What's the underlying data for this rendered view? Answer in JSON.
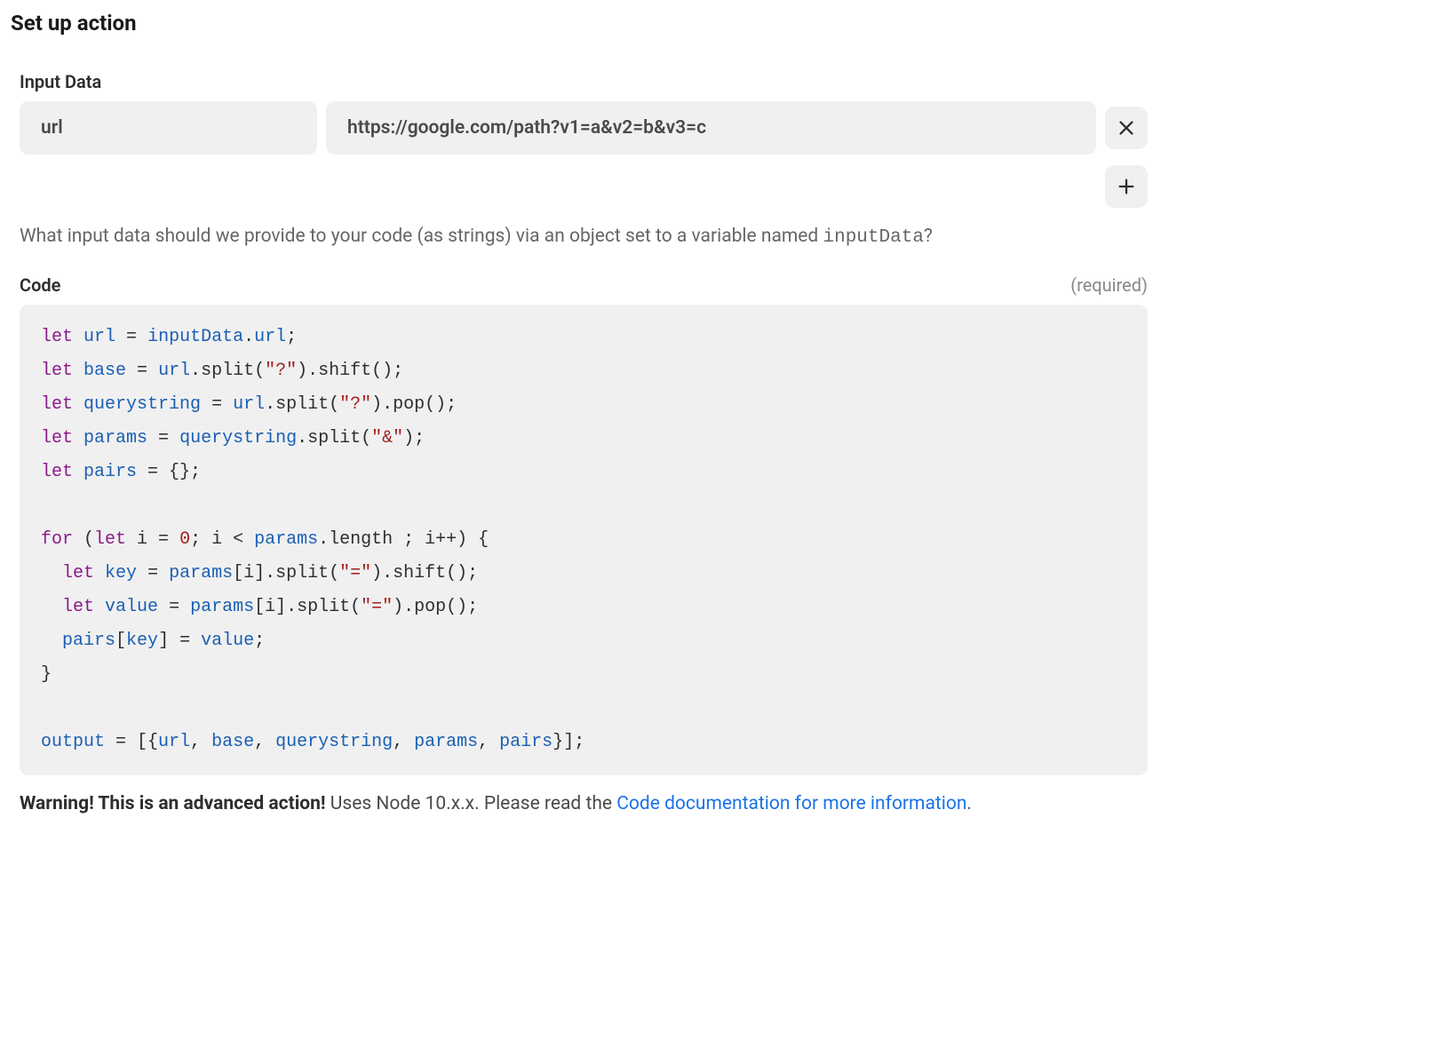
{
  "page": {
    "title": "Set up action"
  },
  "inputData": {
    "label": "Input Data",
    "rows": [
      {
        "key": "url",
        "value": "https://google.com/path?v1=a&v2=b&v3=c"
      }
    ],
    "helperPrefix": "What input data should we provide to your code (as strings) via an object set to a variable named ",
    "helperVar": "inputData",
    "helperSuffix": "?"
  },
  "code": {
    "label": "Code",
    "required": "(required)",
    "value": "let url = inputData.url;\nlet base = url.split(\"?\").shift();\nlet querystring = url.split(\"?\").pop();\nlet params = querystring.split(\"&\");\nlet pairs = {};\n\nfor (let i = 0; i < params.length ; i++) {\n  let key = params[i].split(\"=\").shift();\n  let value = params[i].split(\"=\").pop();\n  pairs[key] = value;\n}\n\noutput = [{url, base, querystring, params, pairs}];"
  },
  "warning": {
    "bold": "Warning! This is an advanced action!",
    "text": " Uses Node 10.x.x. Please read the ",
    "linkText": "Code documentation for more information",
    "suffix": "."
  }
}
